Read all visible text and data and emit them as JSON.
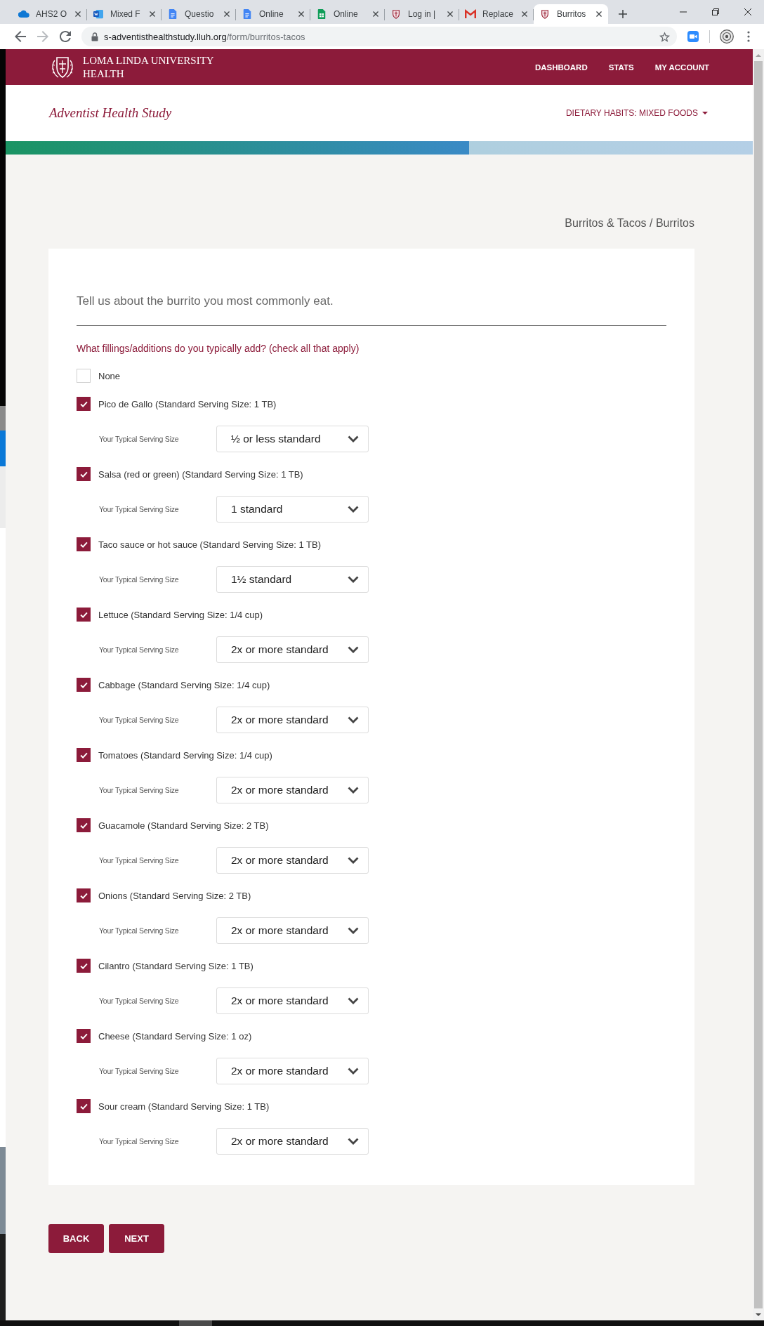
{
  "browser": {
    "tabs": [
      {
        "kind": "cloud",
        "label": "AHS2 O",
        "selected": false
      },
      {
        "kind": "word",
        "label": "Mixed F",
        "selected": false
      },
      {
        "kind": "docs",
        "label": "Questio",
        "selected": false
      },
      {
        "kind": "docs",
        "label": "Online",
        "selected": false
      },
      {
        "kind": "sheets",
        "label": "Online",
        "selected": false
      },
      {
        "kind": "crest",
        "label": "Log in |",
        "selected": false
      },
      {
        "kind": "gmail",
        "label": "Replace",
        "selected": false
      },
      {
        "kind": "crest",
        "label": "Burritos",
        "selected": true
      }
    ],
    "url_host": "s-adventisthealthstudy.lluh.org",
    "url_path": "/form/burritos-tacos"
  },
  "site_header": {
    "logo_lines": [
      "LOMA LINDA UNIVERSITY",
      "HEALTH"
    ],
    "nav": [
      "DASHBOARD",
      "STATS",
      "MY ACCOUNT"
    ]
  },
  "study_header": {
    "title": "Adventist Health Study",
    "section_menu": "DIETARY HABITS: MIXED FOODS"
  },
  "progress": {
    "level": 0.62
  },
  "breadcrumb": "Burritos & Tacos / Burritos",
  "form": {
    "heading": "Tell us about the burrito you most commonly eat.",
    "question": "What fillings/additions do you typically add? (check all that apply)",
    "options": [
      {
        "label": "None",
        "checked": false
      },
      {
        "label": "Pico de Gallo (Standard Serving Size: 1 TB)",
        "checked": true,
        "serving_label": "Your Typical Serving Size",
        "serving_value": "½ or less standard"
      },
      {
        "label": "Salsa (red or green) (Standard Serving Size: 1 TB)",
        "checked": true,
        "serving_label": "Your Typical Serving Size",
        "serving_value": "1 standard"
      },
      {
        "label": "Taco sauce or hot sauce (Standard Serving Size: 1 TB)",
        "checked": true,
        "serving_label": "Your Typical Serving Size",
        "serving_value": "1½ standard"
      },
      {
        "label": "Lettuce (Standard Serving Size: 1/4 cup)",
        "checked": true,
        "serving_label": "Your Typical Serving Size",
        "serving_value": "2x or more standard"
      },
      {
        "label": "Cabbage (Standard Serving Size: 1/4 cup)",
        "checked": true,
        "serving_label": "Your Typical Serving Size",
        "serving_value": "2x or more standard"
      },
      {
        "label": "Tomatoes (Standard Serving Size: 1/4 cup)",
        "checked": true,
        "serving_label": "Your Typical Serving Size",
        "serving_value": "2x or more standard"
      },
      {
        "label": "Guacamole (Standard Serving Size: 2 TB)",
        "checked": true,
        "serving_label": "Your Typical Serving Size",
        "serving_value": "2x or more standard"
      },
      {
        "label": "Onions (Standard Serving Size: 2 TB)",
        "checked": true,
        "serving_label": "Your Typical Serving Size",
        "serving_value": "2x or more standard"
      },
      {
        "label": "Cilantro (Standard Serving Size: 1 TB)",
        "checked": true,
        "serving_label": "Your Typical Serving Size",
        "serving_value": "2x or more standard"
      },
      {
        "label": "Cheese (Standard Serving Size: 1 oz)",
        "checked": true,
        "serving_label": "Your Typical Serving Size",
        "serving_value": "2x or more standard"
      },
      {
        "label": "Sour cream (Standard Serving Size: 1 TB)",
        "checked": true,
        "serving_label": "Your Typical Serving Size",
        "serving_value": "2x or more standard"
      }
    ]
  },
  "buttons": [
    "BACK",
    "NEXT"
  ]
}
